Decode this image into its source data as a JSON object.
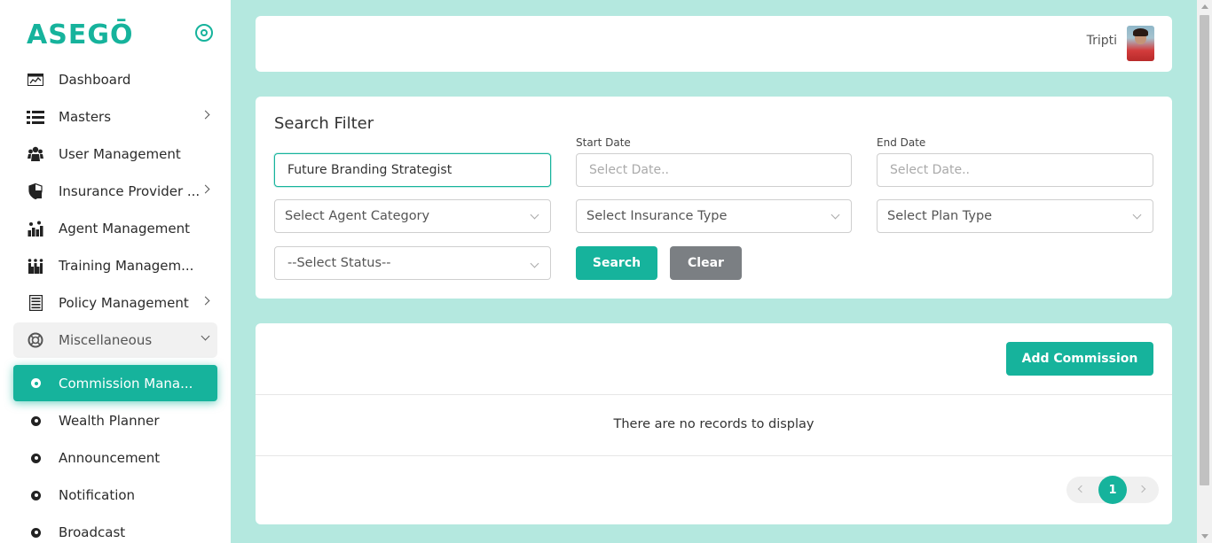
{
  "app": {
    "logo": "ASEGŌ"
  },
  "sidebar": {
    "items": [
      {
        "label": "Dashboard"
      },
      {
        "label": "Masters"
      },
      {
        "label": "User Management"
      },
      {
        "label": "Insurance Provider ..."
      },
      {
        "label": "Agent Management"
      },
      {
        "label": "Training Managem..."
      },
      {
        "label": "Policy Management"
      },
      {
        "label": "Miscellaneous"
      }
    ],
    "sub_items": [
      {
        "label": "Commission Mana..."
      },
      {
        "label": "Wealth Planner"
      },
      {
        "label": "Announcement"
      },
      {
        "label": "Notification"
      },
      {
        "label": "Broadcast"
      }
    ]
  },
  "header": {
    "user_name": "Tripti"
  },
  "filter": {
    "title": "Search Filter",
    "search_value": "Future Branding Strategist",
    "start_date_label": "Start Date",
    "start_date_placeholder": "Select Date..",
    "end_date_label": "End Date",
    "end_date_placeholder": "Select Date..",
    "agent_category": "Select Agent Category",
    "insurance_type": "Select Insurance Type",
    "plan_type": "Select Plan Type",
    "status": "--Select Status--",
    "search_button": "Search",
    "clear_button": "Clear"
  },
  "table": {
    "add_button": "Add Commission",
    "empty_message": "There are no records to display",
    "current_page": "1"
  },
  "colors": {
    "accent": "#16b39c",
    "background": "#b4e8df",
    "grey_button": "#7b7f83"
  }
}
